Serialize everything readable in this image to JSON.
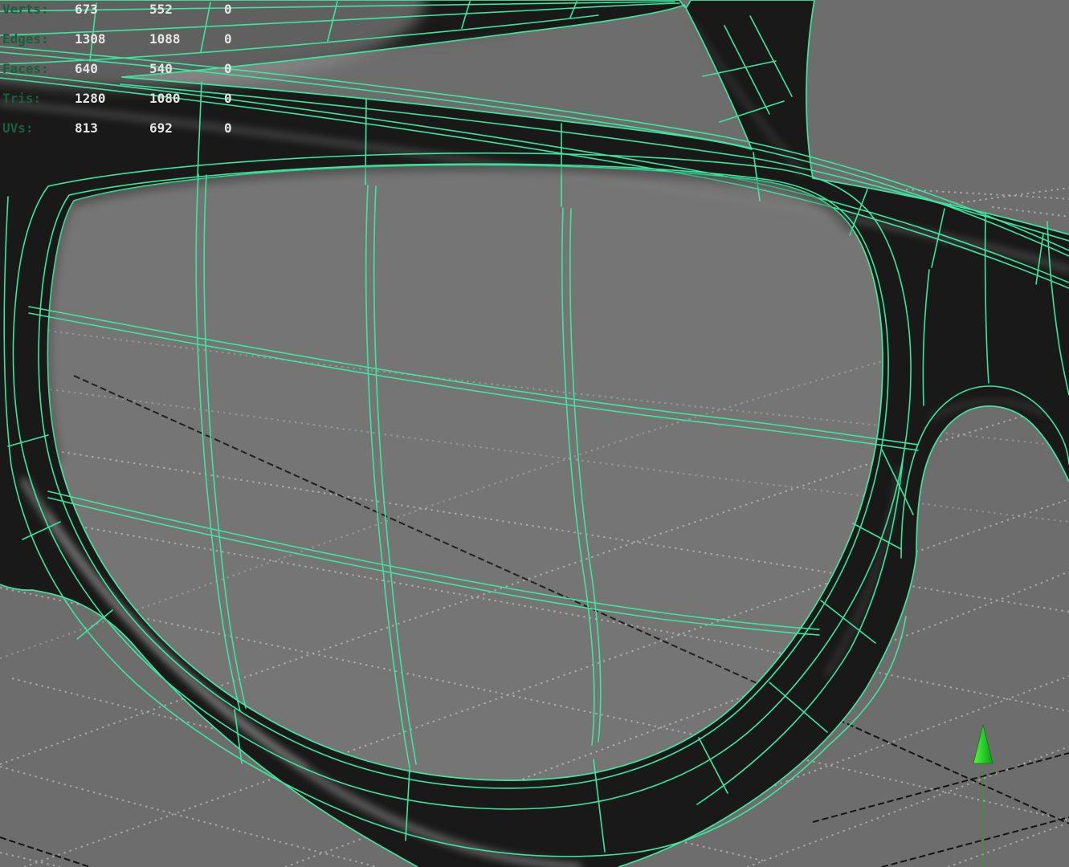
{
  "viewport": {
    "type": "3d-modeling-viewport",
    "background_color": "#6d6d6d",
    "wireframe_color": "#3ce6a0",
    "grid_dot_color": "#ababab",
    "axis_line_color": "#141414",
    "y_axis_arrow_color": "#2ed42e",
    "frame_color": "#191919"
  },
  "hud": {
    "label_color": "#195f3c",
    "value_color": "#e6e6e6",
    "rows": [
      {
        "label": "Verts:",
        "values": [
          "673",
          "552",
          "0"
        ]
      },
      {
        "label": "Edges:",
        "values": [
          "1308",
          "1088",
          "0"
        ]
      },
      {
        "label": "Faces:",
        "values": [
          "640",
          "540",
          "0"
        ]
      },
      {
        "label": "Tris:",
        "values": [
          "1280",
          "1080",
          "0"
        ]
      },
      {
        "label": "UVs:",
        "values": [
          "813",
          "692",
          "0"
        ]
      }
    ]
  }
}
